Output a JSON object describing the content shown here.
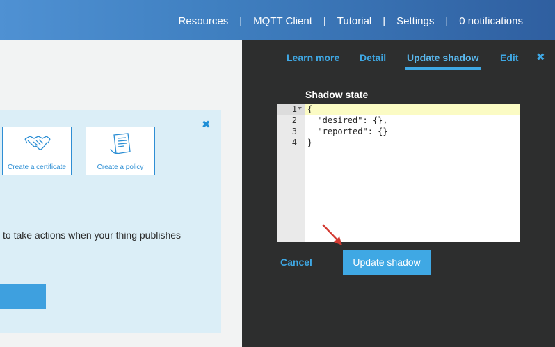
{
  "nav": {
    "items": [
      "Resources",
      "MQTT Client",
      "Tutorial",
      "Settings",
      "0 notifications"
    ],
    "separator": "|"
  },
  "info_panel": {
    "close_icon": "close-icon",
    "cards": [
      {
        "label": "Create a certificate",
        "icon": "handshake-icon"
      },
      {
        "label": "Create a policy",
        "icon": "document-icon"
      }
    ],
    "partial_text": "to take actions when your thing publishes"
  },
  "drawer": {
    "tabs": {
      "learn_more": "Learn more",
      "detail": "Detail",
      "update_shadow": "Update shadow",
      "edit": "Edit"
    },
    "active_tab": "Update shadow",
    "close_icon": "close-icon",
    "section_title": "Shadow state",
    "editor": {
      "line_numbers": [
        "1",
        "2",
        "3",
        "4"
      ],
      "lines": [
        "{",
        "  \"desired\": {},",
        "  \"reported\": {}",
        "}"
      ]
    },
    "cancel_label": "Cancel",
    "update_label": "Update shadow"
  },
  "colors": {
    "accent": "#3fa8e4",
    "drawer_bg": "#2d2e2e",
    "panel_bg": "#dbeef7",
    "arrow": "#d33a32"
  }
}
